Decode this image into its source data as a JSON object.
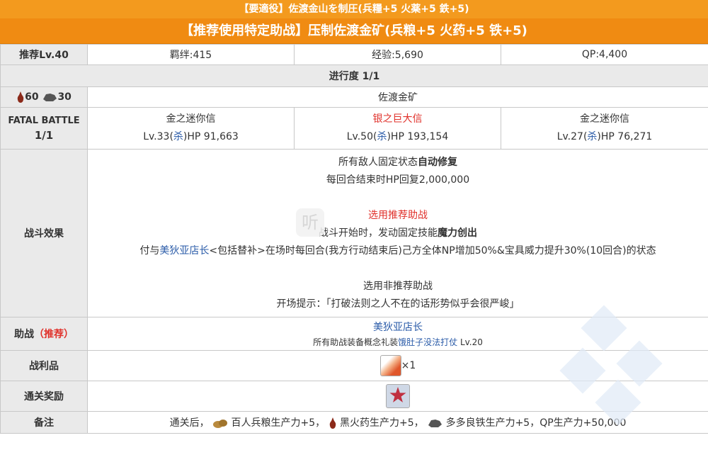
{
  "header": {
    "line1": "【要適役】佐渡金山を制圧(兵糧+5 火薬+5 鉄+5)",
    "line2": "【推荐使用特定助战】压制佐渡金矿(兵粮+5 火药+5 铁+5)"
  },
  "info": {
    "recommend_level": "推荐Lv.40",
    "bond": "羁绊:415",
    "exp": "经验:5,690",
    "qp": "QP:4,400"
  },
  "progress": "进行度 1/1",
  "resources": {
    "gunpowder": "60",
    "iron": "30",
    "stage_name": "佐渡金矿"
  },
  "fatal": {
    "label_line1": "FATAL BATTLE",
    "label_line2": "1/1",
    "enemies": [
      {
        "name": "金之迷你信",
        "level": "Lv.33(",
        "class": "杀",
        "hp": ")HP 91,663"
      },
      {
        "name": "银之巨大信",
        "level": "Lv.50(",
        "class": "杀",
        "hp": ")HP 193,154"
      },
      {
        "name": "金之迷你信",
        "level": "Lv.27(",
        "class": "杀",
        "hp": ")HP 76,271"
      }
    ]
  },
  "effect": {
    "label": "战斗效果",
    "line1a": "所有敌人固定状态",
    "line1b": "自动修复",
    "line2": "每回合结束时HP回复2,000,000",
    "recommended_title": "选用推荐助战",
    "line4a": "战斗开始时，发动固定技能",
    "line4b": "魔力创出",
    "line5a": "付与",
    "line5b": "美狄亚店长",
    "line5c": "<包括替补>在场时每回合(我方行动结束后)己方全体NP增加50%&宝具威力提升30%(10回合)的状态",
    "nonrec_title": "选用非推荐助战",
    "line7": "开场提示：「打破法则之人不在的话形势似乎会很严峻」",
    "watermark": "听"
  },
  "support": {
    "label": "助战",
    "label_tag": "（推荐）",
    "name": "美狄亚店长",
    "equip_prefix": "所有助战装备概念礼装",
    "equip_name": "饿肚子没法打仗",
    "equip_level": " Lv.20"
  },
  "drop": {
    "label": "战利品",
    "count": "×1"
  },
  "clear": {
    "label": "通关奖励"
  },
  "note": {
    "label": "备注",
    "prefix": "通关后，",
    "item1": "百人兵粮生产力+5，",
    "item2": "黑火药生产力+5，",
    "item3": "多多良铁生产力+5，QP生产力+50,000"
  }
}
